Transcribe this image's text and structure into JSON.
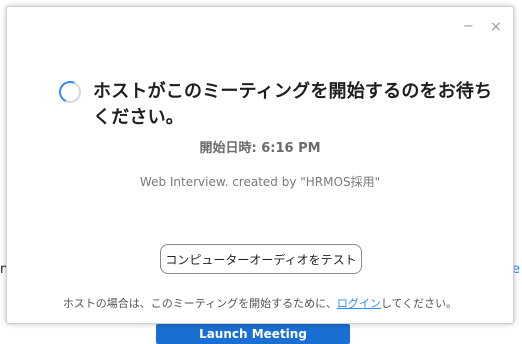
{
  "background": {
    "left_fragment": "n",
    "right_fragment": "e",
    "button_label": "Launch Meeting"
  },
  "window": {
    "minimize_symbol": "−",
    "close_symbol": "×"
  },
  "dialog": {
    "title": "ホストがこのミーティングを開始するのをお待ちください。",
    "start_time_label": "開始日時:",
    "start_time_value": "6:16 PM",
    "meeting_name": "Web Interview. created by \"HRMOS採用\"",
    "test_audio_label": "コンピューターオーディオをテスト",
    "footer_prefix": "ホストの場合は、このミーティングを開始するために、",
    "footer_link": "ログイン",
    "footer_suffix": "してください。"
  },
  "colors": {
    "accent": "#2d8cff",
    "title": "#1f1f1f",
    "muted": "#7a7a7a"
  },
  "icons": {
    "loading": "loading-spinner-icon"
  }
}
